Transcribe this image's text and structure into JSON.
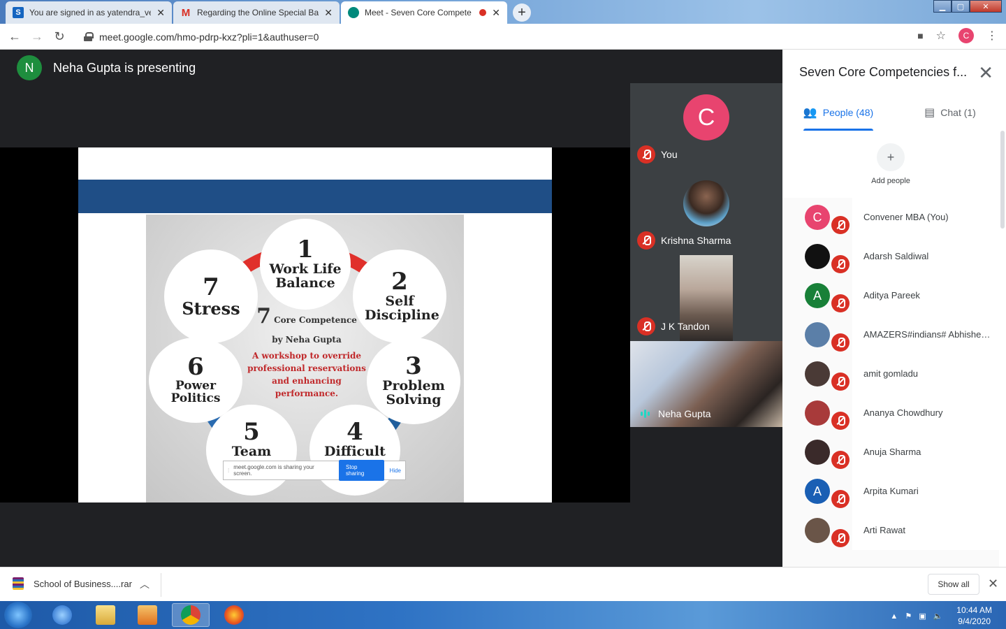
{
  "browser": {
    "tabs": [
      {
        "title": "You are signed in as yatendra_ve",
        "favicon": "S",
        "color": "#1565c0"
      },
      {
        "title": "Regarding the Online Special Ba",
        "favicon": "M",
        "color": "#d93025"
      },
      {
        "title": "Meet - Seven Core Compete",
        "favicon": "meet",
        "color": "#00897b"
      }
    ],
    "url": "meet.google.com/hmo-pdrp-kxz?pli=1&authuser=0",
    "profile_initial": "C"
  },
  "meet": {
    "presenter_initial": "N",
    "presenting_label": "Neha Gupta is presenting",
    "slide": {
      "items": [
        {
          "num": "1",
          "label": "Work Life Balance"
        },
        {
          "num": "2",
          "label": "Self Discipline"
        },
        {
          "num": "3",
          "label": "Problem Solving"
        },
        {
          "num": "4",
          "label": "Difficult"
        },
        {
          "num": "5",
          "label": "Team"
        },
        {
          "num": "6",
          "label": "Power Politics"
        },
        {
          "num": "7",
          "label": "Stress"
        }
      ],
      "center_num": "7",
      "center_title": "Core Competence",
      "center_by": "by Neha Gupta",
      "center_desc": "A workshop to override professional reservations and enhancing performance.",
      "share_text": "meet.google.com is sharing your screen.",
      "stop_label": "Stop sharing",
      "hide_label": "Hide"
    },
    "tiles": [
      {
        "name": "You",
        "initial": "C"
      },
      {
        "name": "Krishna Sharma"
      },
      {
        "name": "J K Tandon"
      },
      {
        "name": "Neha Gupta"
      }
    ]
  },
  "panel": {
    "title": "Seven Core Competencies f...",
    "people_tab": "People (48)",
    "chat_tab": "Chat (1)",
    "add_people": "Add people",
    "people": [
      {
        "name": "Convener MBA (You)",
        "initial": "C",
        "color": "#e8446f"
      },
      {
        "name": "Adarsh Saldiwal",
        "initial": "",
        "color": "#111111"
      },
      {
        "name": "Aditya Pareek",
        "initial": "A",
        "color": "#188038"
      },
      {
        "name": "AMAZERS#indians# Abhishek ...",
        "initial": "",
        "color": "#5b7fa8"
      },
      {
        "name": "amit gomladu",
        "initial": "",
        "color": "#4a3a36"
      },
      {
        "name": "Ananya Chowdhury",
        "initial": "",
        "color": "#a83a3a"
      },
      {
        "name": "Anuja Sharma",
        "initial": "",
        "color": "#3a2a2a"
      },
      {
        "name": "Arpita Kumari",
        "initial": "A",
        "color": "#1a5fb4"
      },
      {
        "name": "Arti Rawat",
        "initial": "",
        "color": "#6a5548"
      }
    ]
  },
  "downloads": {
    "file": "School of Business....rar",
    "show_all": "Show all"
  },
  "taskbar": {
    "time": "10:44 AM",
    "date": "9/4/2020"
  }
}
